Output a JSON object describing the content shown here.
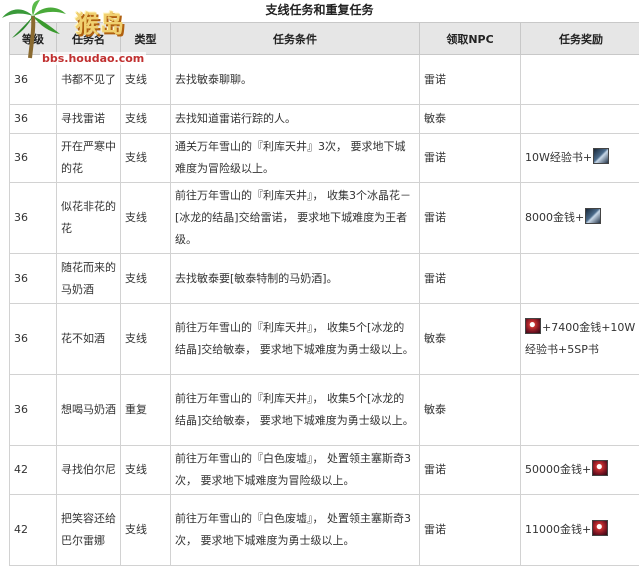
{
  "page_title": "支线任务和重复任务",
  "logo": {
    "site": "bbs.houdao.com"
  },
  "headers": [
    "等级",
    "任务名",
    "类型",
    "任务条件",
    "领取NPC",
    "任务奖励"
  ],
  "rows": [
    {
      "level": "36",
      "name": "书都不见了",
      "type": "支线",
      "condition": "去找敏泰聊聊。",
      "npc": "雷诺",
      "reward": "",
      "icon": "",
      "icon_pos": ""
    },
    {
      "level": "36",
      "name": "寻找雷诺",
      "type": "支线",
      "condition": "去找知道雷诺行踪的人。",
      "npc": "敏泰",
      "reward": "",
      "icon": "",
      "icon_pos": ""
    },
    {
      "level": "36",
      "name": "开在严寒中的花",
      "type": "支线",
      "condition": "通关万年雪山的『利库天井』3次， 要求地下城难度为冒险级以上。",
      "npc": "雷诺",
      "reward": "10W经验书+",
      "icon": "exp-book-icon",
      "icon_pos": "after"
    },
    {
      "level": "36",
      "name": "似花非花的花",
      "type": "支线",
      "condition": "前往万年雪山的『利库天井』， 收集3个冰晶花－[冰龙的结晶]交给雷诺， 要求地下城难度为王者级。",
      "npc": "雷诺",
      "reward": "8000金钱+",
      "icon": "exp-book-icon",
      "icon_pos": "after"
    },
    {
      "level": "36",
      "name": "随花而来的马奶酒",
      "type": "支线",
      "condition": "去找敏泰要[敏泰特制的马奶酒]。",
      "npc": "雷诺",
      "reward": "",
      "icon": "",
      "icon_pos": ""
    },
    {
      "level": "36",
      "name": "花不如酒",
      "type": "支线",
      "condition": "前往万年雪山的『利库天井』， 收集5个[冰龙的结晶]交给敏泰， 要求地下城难度为勇士级以上。",
      "npc": "敏泰",
      "reward": "+7400金钱+10W经验书+5SP书",
      "icon": "item-box-icon",
      "icon_pos": "before"
    },
    {
      "level": "36",
      "name": "想喝马奶酒",
      "type": "重复",
      "condition": "前往万年雪山的『利库天井』， 收集5个[冰龙的结晶]交给敏泰， 要求地下城难度为勇士级以上。",
      "npc": "敏泰",
      "reward": "",
      "icon": "",
      "icon_pos": ""
    },
    {
      "level": "42",
      "name": "寻找伯尔尼",
      "type": "支线",
      "condition": "前往万年雪山的『白色废墟』， 处置领主塞斯奇3次， 要求地下城难度为冒险级以上。",
      "npc": "雷诺",
      "reward": "50000金钱+",
      "icon": "item-box-icon",
      "icon_pos": "after"
    },
    {
      "level": "42",
      "name": "把笑容还给巴尔雷娜",
      "type": "支线",
      "condition": "前往万年雪山的『白色废墟』， 处置领主塞斯奇3次， 要求地下城难度为勇士级以上。",
      "npc": "雷诺",
      "reward": "11000金钱+",
      "icon": "item-box-icon",
      "icon_pos": "after"
    }
  ]
}
